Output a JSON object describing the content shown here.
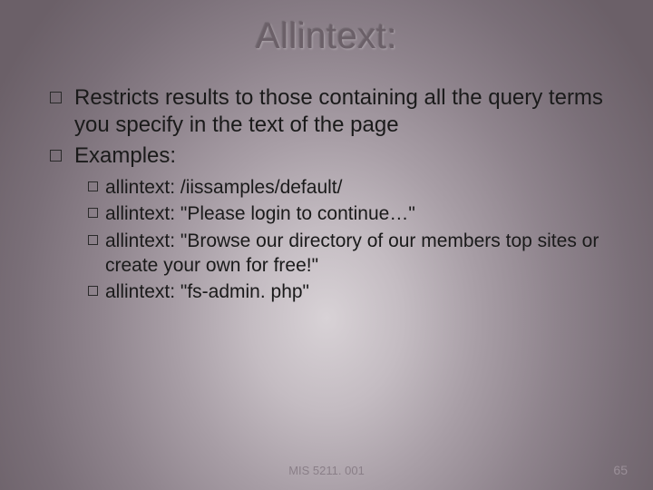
{
  "title": "Allintext:",
  "bullets": {
    "main1": "Restricts results to those containing all the query terms you specify in the text of the page",
    "main2": "Examples:",
    "sub1": "allintext: /iissamples/default/",
    "sub2": "allintext: \"Please login to continue…\"",
    "sub3": "allintext: \"Browse our directory of our members top sites or create your own for free!\"",
    "sub4": "allintext: \"fs-admin. php\""
  },
  "footer": {
    "center": "MIS 5211. 001",
    "page": "65"
  }
}
